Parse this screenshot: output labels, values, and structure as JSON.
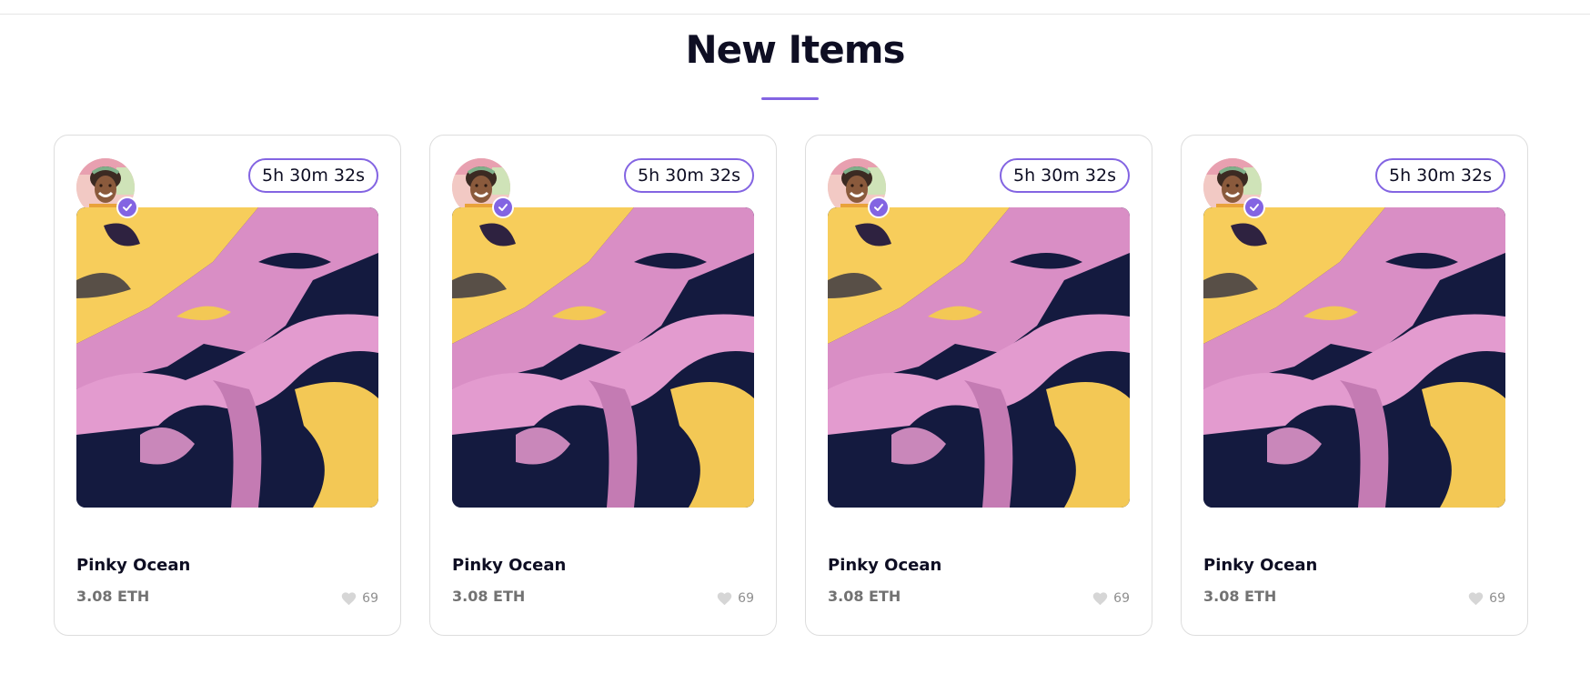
{
  "section": {
    "title": "New Items"
  },
  "colors": {
    "accent": "#8364e2",
    "heart": "#d6d6d6"
  },
  "items": [
    {
      "countdown": "5h 30m 32s",
      "name": "Pinky Ocean",
      "price": "3.08 ETH",
      "likes": "69",
      "verified_icon": "check-icon",
      "like_icon": "heart-icon"
    },
    {
      "countdown": "5h 30m 32s",
      "name": "Pinky Ocean",
      "price": "3.08 ETH",
      "likes": "69",
      "verified_icon": "check-icon",
      "like_icon": "heart-icon"
    },
    {
      "countdown": "5h 30m 32s",
      "name": "Pinky Ocean",
      "price": "3.08 ETH",
      "likes": "69",
      "verified_icon": "check-icon",
      "like_icon": "heart-icon"
    },
    {
      "countdown": "5h 30m 32s",
      "name": "Pinky Ocean",
      "price": "3.08 ETH",
      "likes": "69",
      "verified_icon": "check-icon",
      "like_icon": "heart-icon"
    }
  ]
}
